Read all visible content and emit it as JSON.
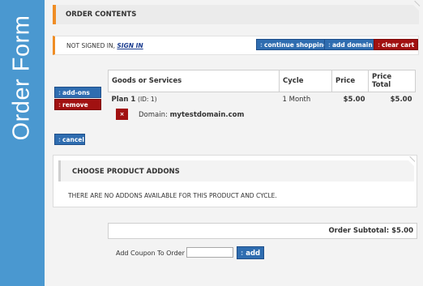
{
  "sidebar": {
    "title": "Order Form"
  },
  "header": {
    "title": "ORDER CONTENTS"
  },
  "signin": {
    "prefix": "NOT SIGNED IN, ",
    "link": "SIGN IN"
  },
  "actions": {
    "continue_shopping": "continue shopping",
    "add_domain": "add domain",
    "clear_cart": "clear cart"
  },
  "cart": {
    "columns": [
      "Goods or Services",
      "Cycle",
      "Price",
      "Price Total"
    ],
    "item": {
      "name": "Plan 1",
      "id_text": "(ID: 1)",
      "cycle": "1 Month",
      "price": "$5.00",
      "total": "$5.00",
      "addons_label": "add-ons",
      "remove_label": "remove",
      "domain_prefix": "Domain:",
      "domain": "mytestdomain.com",
      "remove_domain_label": "×"
    },
    "cancel_label": "cancel"
  },
  "addons": {
    "title": "CHOOSE PRODUCT ADDONS",
    "message": "THERE ARE NO ADDONS AVAILABLE FOR THIS PRODUCT AND CYCLE."
  },
  "subtotal": {
    "label": "Order Subtotal:",
    "value": "$5.00"
  },
  "coupon": {
    "label": "Add Coupon To Order",
    "placeholder": "",
    "value": "",
    "button": "add"
  },
  "colors": {
    "sidebar": "#4a98d0",
    "accent": "#ef8d25",
    "button_blue": "#2f6db0",
    "button_red": "#a11111"
  }
}
